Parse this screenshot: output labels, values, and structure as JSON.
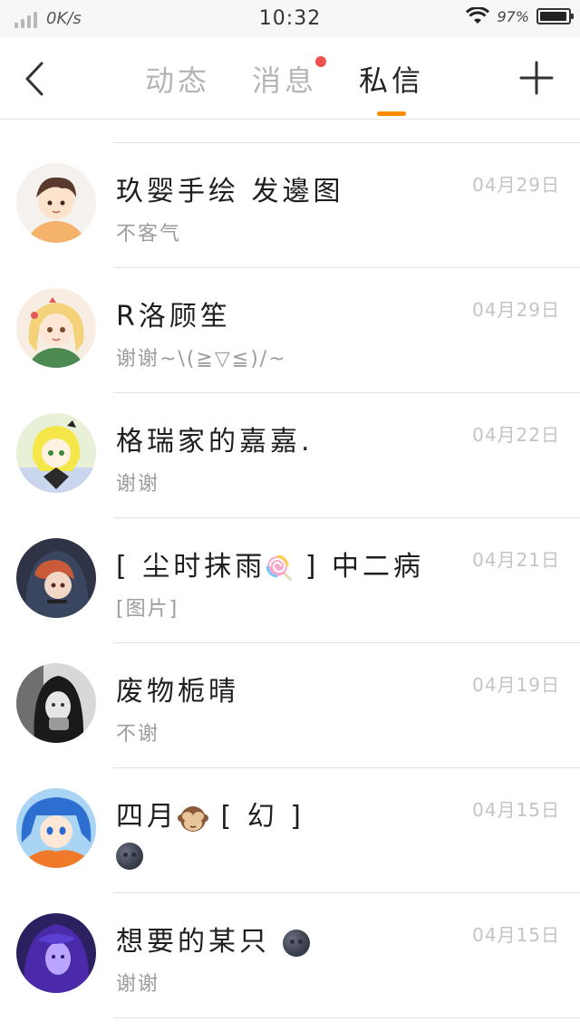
{
  "status_bar": {
    "speed": "0K/s",
    "time": "10:32",
    "battery_text": "97%",
    "battery_level": 0.97
  },
  "nav": {
    "tabs": [
      {
        "label": "动态",
        "active": false,
        "badge": false
      },
      {
        "label": "消息",
        "active": false,
        "badge": true
      },
      {
        "label": "私信",
        "active": true,
        "badge": false
      }
    ],
    "accent_color": "#ff8a00",
    "badge_color": "#f05050"
  },
  "messages": [
    {
      "name": "玖婴手绘 发邊图",
      "preview": "不客气",
      "date": "04月29日"
    },
    {
      "name": "R洛顾笙",
      "preview": "谢谢~\\(≧▽≦)/~",
      "date": "04月29日"
    },
    {
      "name": "格瑞家的嘉嘉.",
      "preview": "谢谢",
      "date": "04月22日"
    },
    {
      "name_before": "[ 尘时抹雨",
      "name_icon": "lollipop-icon",
      "name_after": " ] 中二病",
      "preview": "[图片]",
      "date": "04月21日"
    },
    {
      "name": "废物栀晴",
      "preview": "不谢",
      "date": "04月19日"
    },
    {
      "name_before": "四月",
      "name_icon": "see-no-evil-monkey-icon",
      "name_after": " [ 幻 ]",
      "preview_icon": "new-moon-face-icon",
      "date": "04月15日"
    },
    {
      "name_before": "想要的某只",
      "name_icon": "new-moon-face-icon",
      "preview": "谢谢",
      "date": "04月15日"
    }
  ]
}
